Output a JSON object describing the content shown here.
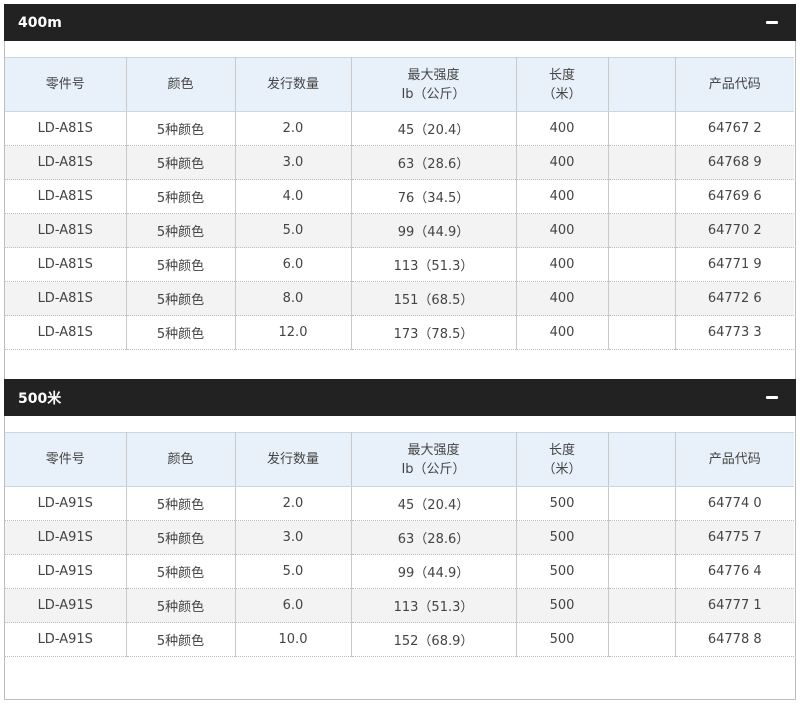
{
  "sections": [
    {
      "title": "400m",
      "headers": {
        "part_no": "零件号",
        "color": "颜色",
        "issue_qty": "发行数量",
        "max_strength_line1": "最大强度",
        "max_strength_line2": "Ib（公斤）",
        "length_line1": "长度",
        "length_line2": "（米）",
        "blank": "",
        "product_code": "产品代码"
      },
      "rows": [
        {
          "part": "LD-A81S",
          "color": "5种颜色",
          "qty": "2.0",
          "strength": "45（20.4）",
          "length": "400",
          "code": "64767 2"
        },
        {
          "part": "LD-A81S",
          "color": "5种颜色",
          "qty": "3.0",
          "strength": "63（28.6）",
          "length": "400",
          "code": "64768 9"
        },
        {
          "part": "LD-A81S",
          "color": "5种颜色",
          "qty": "4.0",
          "strength": "76（34.5）",
          "length": "400",
          "code": "64769 6"
        },
        {
          "part": "LD-A81S",
          "color": "5种颜色",
          "qty": "5.0",
          "strength": "99（44.9）",
          "length": "400",
          "code": "64770 2"
        },
        {
          "part": "LD-A81S",
          "color": "5种颜色",
          "qty": "6.0",
          "strength": "113（51.3）",
          "length": "400",
          "code": "64771 9"
        },
        {
          "part": "LD-A81S",
          "color": "5种颜色",
          "qty": "8.0",
          "strength": "151（68.5）",
          "length": "400",
          "code": "64772 6"
        },
        {
          "part": "LD-A81S",
          "color": "5种颜色",
          "qty": "12.0",
          "strength": "173（78.5）",
          "length": "400",
          "code": "64773 3"
        }
      ]
    },
    {
      "title": "500米",
      "headers": {
        "part_no": "零件号",
        "color": "颜色",
        "issue_qty": "发行数量",
        "max_strength_line1": "最大强度",
        "max_strength_line2": "Ib（公斤）",
        "length_line1": "长度",
        "length_line2": "（米）",
        "blank": "",
        "product_code": "产品代码"
      },
      "rows": [
        {
          "part": "LD-A91S",
          "color": "5种颜色",
          "qty": "2.0",
          "strength": "45（20.4）",
          "length": "500",
          "code": "64774 0"
        },
        {
          "part": "LD-A91S",
          "color": "5种颜色",
          "qty": "3.0",
          "strength": "63（28.6）",
          "length": "500",
          "code": "64775 7"
        },
        {
          "part": "LD-A91S",
          "color": "5种颜色",
          "qty": "5.0",
          "strength": "99（44.9）",
          "length": "500",
          "code": "64776 4"
        },
        {
          "part": "LD-A91S",
          "color": "5种颜色",
          "qty": "6.0",
          "strength": "113（51.3）",
          "length": "500",
          "code": "64777 1"
        },
        {
          "part": "LD-A91S",
          "color": "5种颜色",
          "qty": "10.0",
          "strength": "152（68.9）",
          "length": "500",
          "code": "64778 8"
        }
      ]
    }
  ],
  "icons": {
    "collapse": "minus-icon"
  },
  "colors": {
    "header_bar": "#222222",
    "table_header_bg": "#e8f1fa",
    "row_alt_bg": "#f3f3f3"
  }
}
